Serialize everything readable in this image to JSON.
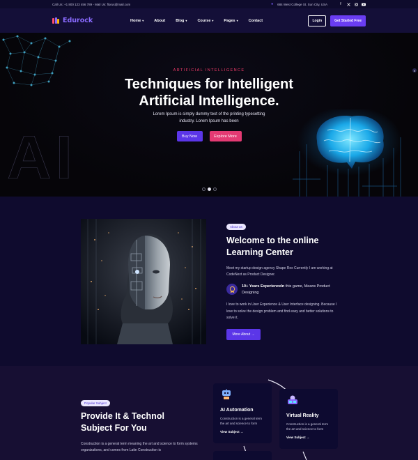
{
  "topbar": {
    "contact": "Call Us: +1 800 123 456 789 - Mail Us: florus@mail.com",
    "address": "684 West College St. Sun City, USA"
  },
  "nav": {
    "brand": "Edurock",
    "menu": [
      {
        "label": "Home",
        "dropdown": true
      },
      {
        "label": "About",
        "dropdown": false
      },
      {
        "label": "Blog",
        "dropdown": true
      },
      {
        "label": "Course",
        "dropdown": true
      },
      {
        "label": "Pages",
        "dropdown": true
      },
      {
        "label": "Contact",
        "dropdown": false
      }
    ],
    "login": "Login",
    "cta": "Get Started Free"
  },
  "hero": {
    "kicker": "ARTIFICIAL INTELLIGENCE",
    "title_line1": "Techniques for Intelligent",
    "title_line2": "Artificial Intelligence.",
    "sub_line1": "Lorem Ipsum is simply dummy text of the printing typesetting",
    "sub_line2": "industry. Lorem Ipsum has been",
    "primary_btn": "Buy Now",
    "secondary_btn": "Explore More",
    "bg_text": "AI",
    "slides": 3,
    "active_slide": 2
  },
  "about": {
    "badge": "About us",
    "title_line1": "Welcome to the online",
    "title_line2": "Learning Center",
    "para1": "Meet my startup design agency Shape Rex Currently I am working at CodeNext as Product Designer.",
    "exp_bold": "10+ Years ExperienceIn",
    "exp_rest": " this game, Means Product Designing",
    "para2": "I love to work in User Experience & User Interface designing. Because I love to solve the design problem and find easy and better solutions to solve it.",
    "button": "More About →"
  },
  "subject": {
    "badge": "Popular Subject",
    "title_line1": "Provide It & Technol",
    "title_line2": "Subject For You",
    "para": "Construction is a general term meaning the art and science to form systems organizations, and comes from Latin Construction is",
    "cards": [
      {
        "title": "AI Automation",
        "text": "Construction is a general term the art and science to form",
        "link": "View Subject →"
      },
      {
        "title": "Virtual Reality",
        "text": "Construction is a general term the art and science to form",
        "link": "View Subject →"
      }
    ]
  },
  "colors": {
    "accent": "#5b36e8",
    "pink": "#e43a73",
    "brand": "#8a6bff",
    "bg": "#0f0b2e"
  }
}
